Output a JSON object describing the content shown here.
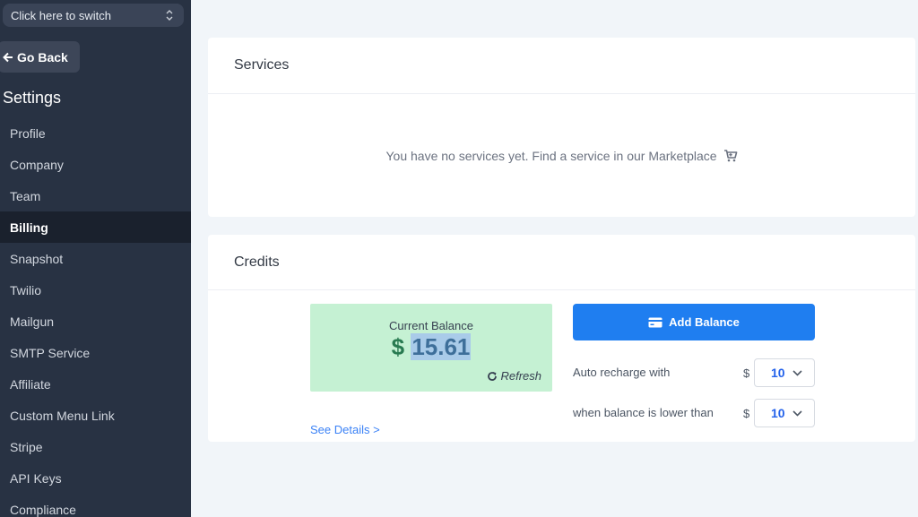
{
  "sidebar": {
    "switcher_label": "Click here to switch",
    "go_back_label": "Go Back",
    "title": "Settings",
    "items": [
      {
        "label": "Profile",
        "active": false
      },
      {
        "label": "Company",
        "active": false
      },
      {
        "label": "Team",
        "active": false
      },
      {
        "label": "Billing",
        "active": true
      },
      {
        "label": "Snapshot",
        "active": false
      },
      {
        "label": "Twilio",
        "active": false
      },
      {
        "label": "Mailgun",
        "active": false
      },
      {
        "label": "SMTP Service",
        "active": false
      },
      {
        "label": "Affiliate",
        "active": false
      },
      {
        "label": "Custom Menu Link",
        "active": false
      },
      {
        "label": "Stripe",
        "active": false
      },
      {
        "label": "API Keys",
        "active": false
      },
      {
        "label": "Compliance",
        "active": false
      }
    ]
  },
  "services": {
    "title": "Services",
    "empty_message": "You have no services yet. Find a service in our Marketplace",
    "icon": "cart-icon"
  },
  "credits": {
    "title": "Credits",
    "balance_label": "Current Balance",
    "currency_symbol": "$",
    "balance_value": "15.61",
    "refresh_label": "Refresh",
    "see_details_label": "See Details >",
    "add_balance_label": "Add Balance",
    "auto_recharge_label": "Auto recharge with",
    "auto_recharge_currency": "$",
    "auto_recharge_value": "10",
    "threshold_label": "when balance is lower than",
    "threshold_currency": "$",
    "threshold_value": "10"
  },
  "colors": {
    "sidebar_bg": "#283243",
    "active_item_bg": "#1a212d",
    "primary_button": "#1f7ef0",
    "balance_box_bg": "#c5f1d3",
    "balance_text": "#287a50",
    "link": "#3b82f6"
  }
}
